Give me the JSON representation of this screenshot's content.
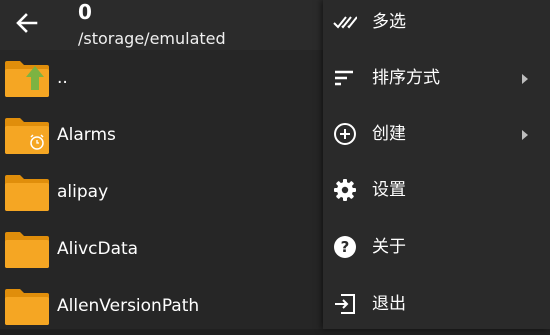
{
  "app_bar": {
    "title": "0",
    "path": "/storage/emulated",
    "back_icon": "arrow-left-icon"
  },
  "files": [
    {
      "name": "..",
      "icon": "folder-up-icon"
    },
    {
      "name": "Alarms",
      "icon": "folder-alarm-icon"
    },
    {
      "name": "alipay",
      "icon": "folder-icon"
    },
    {
      "name": "AlivcData",
      "icon": "folder-icon"
    },
    {
      "name": "AllenVersionPath",
      "icon": "folder-icon"
    }
  ],
  "menu": {
    "items": [
      {
        "label": "多选",
        "icon": "multi-check-icon",
        "submenu": false
      },
      {
        "label": "排序方式",
        "icon": "sort-icon",
        "submenu": true
      },
      {
        "label": "创建",
        "icon": "add-circle-icon",
        "submenu": true
      },
      {
        "label": "设置",
        "icon": "gear-icon",
        "submenu": false
      },
      {
        "label": "关于",
        "icon": "help-icon",
        "submenu": false
      },
      {
        "label": "退出",
        "icon": "exit-icon",
        "submenu": false
      }
    ]
  },
  "colors": {
    "folder": "#f5a623",
    "folder_dark": "#e08e0b",
    "up_arrow": "#7cb342",
    "background": "#262626",
    "menu_background": "#2a2a2a",
    "app_bar": "#2b2b2b"
  }
}
